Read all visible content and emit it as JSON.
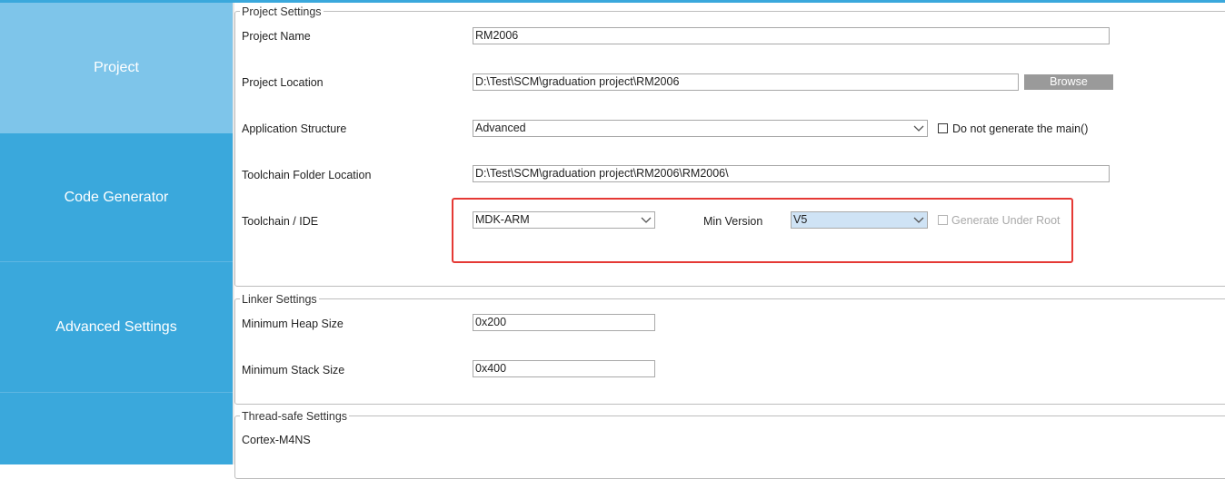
{
  "sidebar": {
    "items": [
      {
        "label": "Project",
        "active": true
      },
      {
        "label": "Code Generator",
        "active": false
      },
      {
        "label": "Advanced Settings",
        "active": false
      },
      {
        "label": "",
        "active": false
      }
    ]
  },
  "project_settings": {
    "legend": "Project Settings",
    "project_name": {
      "label": "Project Name",
      "value": "RM2006"
    },
    "project_location": {
      "label": "Project Location",
      "value": "D:\\Test\\SCM\\graduation project\\RM2006",
      "browse_label": "Browse"
    },
    "application_structure": {
      "label": "Application Structure",
      "value": "Advanced",
      "checkbox_label": "Do not generate the main()",
      "checked": false
    },
    "toolchain_folder": {
      "label": "Toolchain Folder Location",
      "value": "D:\\Test\\SCM\\graduation project\\RM2006\\RM2006\\"
    },
    "toolchain_ide": {
      "label": "Toolchain / IDE",
      "value": "MDK-ARM",
      "min_version_label": "Min Version",
      "min_version_value": "V5",
      "generate_root_label": "Generate Under Root",
      "generate_root_enabled": false
    }
  },
  "linker_settings": {
    "legend": "Linker Settings",
    "heap": {
      "label": "Minimum Heap Size",
      "value": "0x200"
    },
    "stack": {
      "label": "Minimum Stack Size",
      "value": "0x400"
    }
  },
  "thread_safe_settings": {
    "legend": "Thread-safe Settings",
    "core": "Cortex-M4NS"
  },
  "colors": {
    "sidebar": "#3aa8dc",
    "sidebar_active": "#7ec5ea",
    "highlight_box": "#e53935",
    "browse_button": "#9a9a9a",
    "selected_combo": "#cfe3f5"
  }
}
